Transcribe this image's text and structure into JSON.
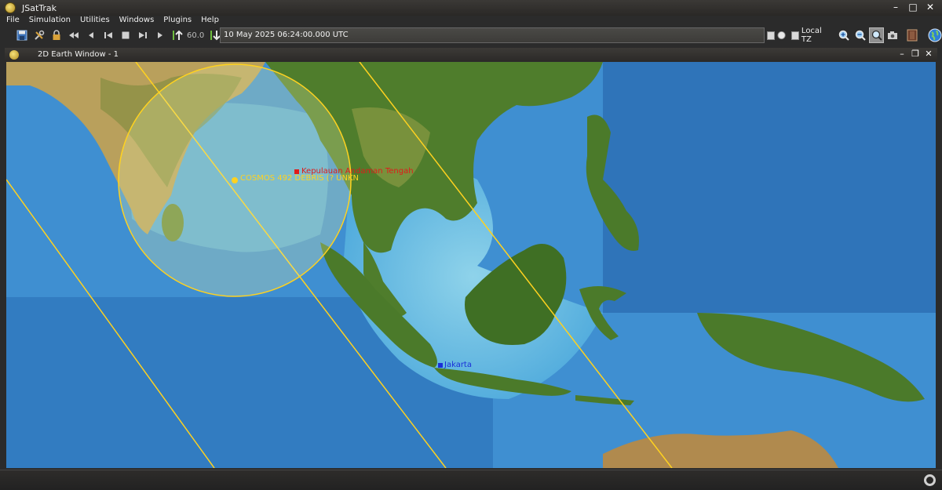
{
  "window": {
    "title": "JSatTrak"
  },
  "menu": [
    "File",
    "Simulation",
    "Utilities",
    "Windows",
    "Plugins",
    "Help"
  ],
  "toolbar": {
    "step_value": "60.0",
    "time": "10 May 2025 06:24:00.000 UTC",
    "local_tz_label": "Local TZ"
  },
  "subwindow": {
    "title": "2D Earth Window - 1"
  },
  "map": {
    "satellite_label": "COSMOS 492 DEBRIS (? UNKN",
    "ground_station_1": "Kepulauan Andaman Tengah",
    "ground_station_2": "Jakarta",
    "colors": {
      "track": "#ffd21f",
      "satellite": "#ffd21f",
      "station_1": "#e01a1a",
      "station_2": "#1a2fd8",
      "ocean_deep": "#1d5fa8",
      "ocean_shallow": "#8fd3ea",
      "land": "#4f7d2c",
      "land_dry": "#b9a05c"
    }
  },
  "icons": {
    "save": "save-icon",
    "tools": "tools-icon",
    "lock": "lock-icon",
    "rewind": "fast-rewind-icon",
    "step_back": "step-back-icon",
    "reset": "reset-icon",
    "stop": "stop-icon",
    "step_forward": "step-forward-icon",
    "play": "play-icon",
    "increase": "step-increase-icon",
    "decrease": "step-decrease-icon",
    "zoom_in": "zoom-in-icon",
    "zoom_out": "zoom-out-icon",
    "zoom_box": "zoom-box-icon",
    "camera": "camera-icon",
    "book": "book-icon",
    "globe": "globe-icon"
  }
}
